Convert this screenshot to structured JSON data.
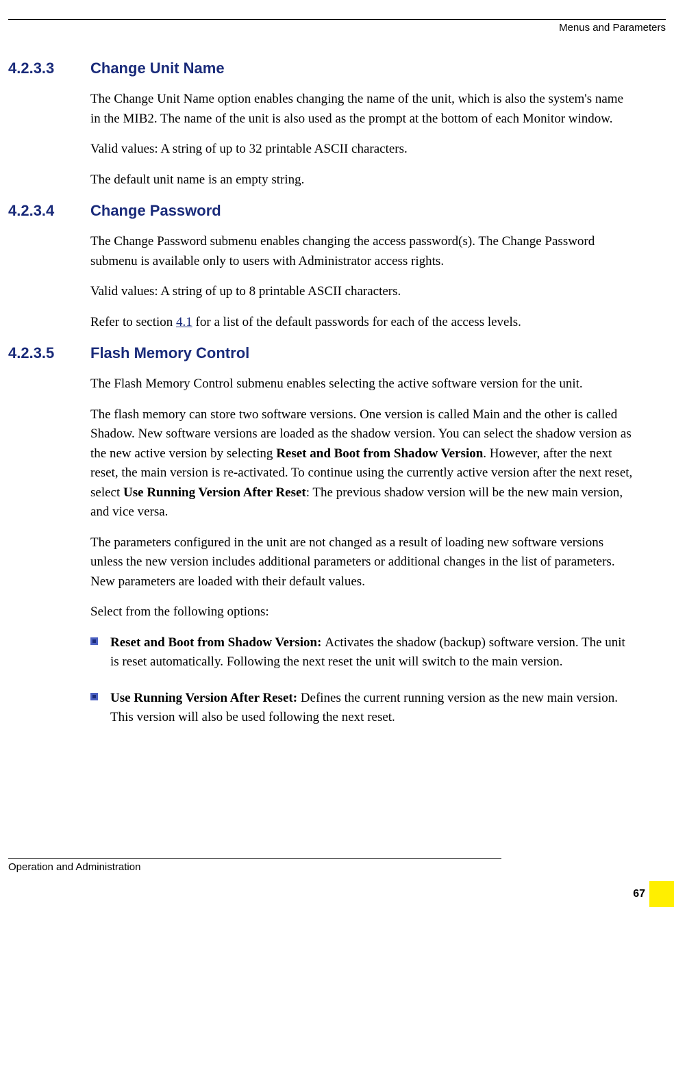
{
  "header": {
    "right_text": "Menus and Parameters"
  },
  "sections": [
    {
      "number": "4.2.3.3",
      "title": "Change Unit Name",
      "paragraphs": [
        "The Change Unit Name option enables changing the name of the unit, which is also the system's name in the MIB2. The name of the unit is also used as the prompt at the bottom of each Monitor window.",
        "Valid values: A string of up to 32 printable ASCII characters.",
        "The default unit name is an empty string."
      ]
    },
    {
      "number": "4.2.3.4",
      "title": "Change Password",
      "paragraphs": [
        "The Change Password submenu enables changing the access password(s). The Change Password submenu is available only to users with Administrator access rights.",
        "Valid values: A string of up to 8 printable ASCII characters."
      ],
      "ref_prefix": "Refer to section ",
      "ref_link": "4.1",
      "ref_suffix": " for a list of the default passwords for each of the access levels."
    },
    {
      "number": "4.2.3.5",
      "title": "Flash Memory Control",
      "paragraphs": [
        "The Flash Memory Control submenu enables selecting the active software version for the unit."
      ],
      "rich_paragraph": {
        "p1": "The flash memory can store two software versions. One version is called Main and the other is called Shadow. New software versions are loaded as the shadow version. You can select the shadow version as the new active version by selecting ",
        "b1": "Reset and Boot from Shadow Version",
        "p2": ". However, after the next reset, the main version is re-activated. To continue using the currently active version after the next reset, select ",
        "b2": "Use Running Version After Reset",
        "p3": ": The previous shadow version will be the new main version, and vice versa."
      },
      "after_paragraphs": [
        "The parameters configured in the unit are not changed as a result of loading new software versions unless the new version includes additional parameters or additional changes in the list of parameters. New parameters are loaded with their default values.",
        "Select from the following options:"
      ],
      "bullets": [
        {
          "bold": "Reset and Boot from Shadow Version: ",
          "text": "Activates the shadow (backup) software version. The unit is reset automatically. Following the next reset the unit will switch to the main version."
        },
        {
          "bold": "Use Running Version After Reset: ",
          "text": "Defines the current running version as the new main version. This version will also be used following the next reset."
        }
      ]
    }
  ],
  "footer": {
    "left_text": "Operation and Administration",
    "page_number": "67"
  }
}
